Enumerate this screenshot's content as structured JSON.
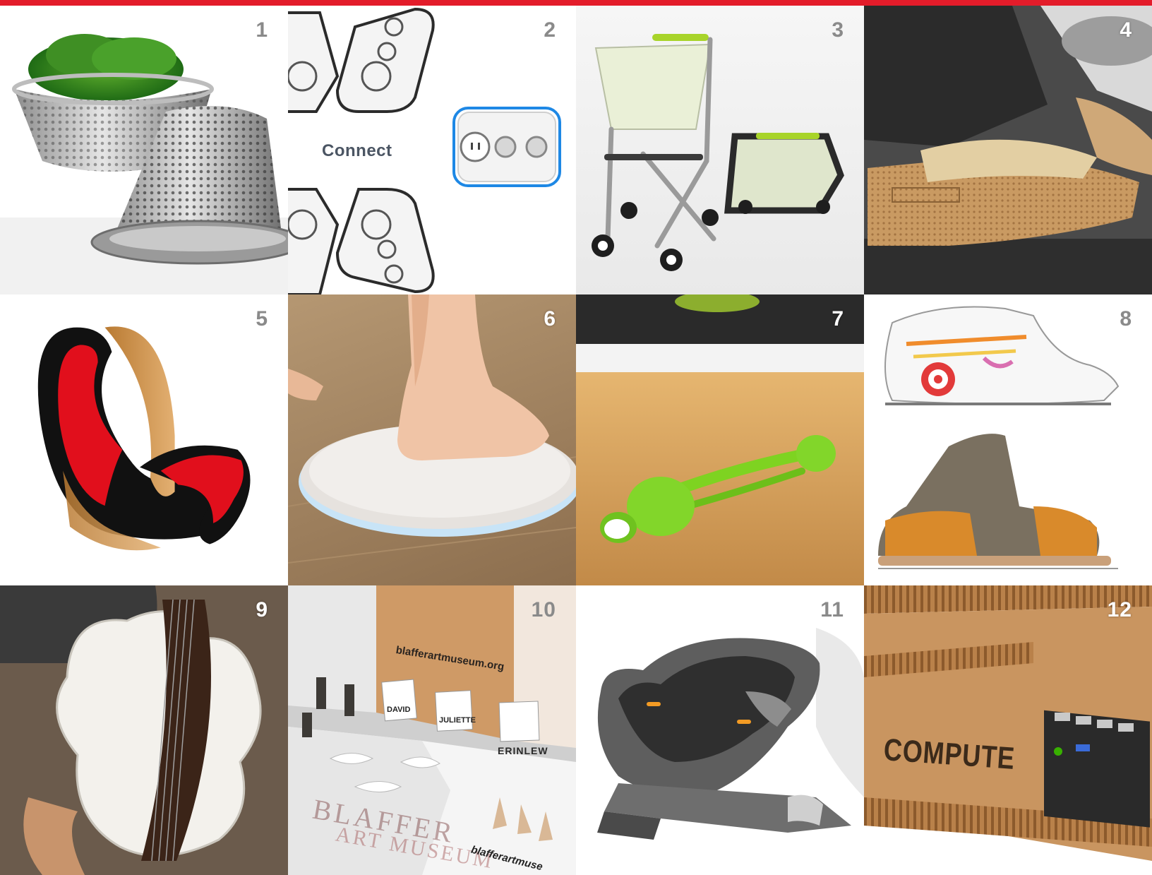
{
  "accent_color": "#e31c2a",
  "tiles": [
    {
      "number": "1",
      "subject": "colander-bowls"
    },
    {
      "number": "2",
      "subject": "power-outlet-modules",
      "label": "Connect"
    },
    {
      "number": "3",
      "subject": "folding-shopping-cart"
    },
    {
      "number": "4",
      "subject": "cardboard-shoe-sole"
    },
    {
      "number": "5",
      "subject": "ribbon-chair"
    },
    {
      "number": "6",
      "subject": "foot-scale"
    },
    {
      "number": "7",
      "subject": "green-measuring-spoons"
    },
    {
      "number": "8",
      "subject": "sneaker-sketches"
    },
    {
      "number": "9",
      "subject": "guitar-form"
    },
    {
      "number": "10",
      "subject": "museum-exhibit",
      "wall_url": "blafferartmuseum.org",
      "card_1": "DAVID",
      "card_2": "JULIETTE",
      "card_3_name": "ERINLEW",
      "wall_text_1": "BLAFFER",
      "wall_text_2": "ART MUSEUM",
      "pedestal_url": "blafferartmuse"
    },
    {
      "number": "11",
      "subject": "infant-car-seat"
    },
    {
      "number": "12",
      "subject": "cardboard-computer-case",
      "label": "COMPUTE"
    }
  ]
}
